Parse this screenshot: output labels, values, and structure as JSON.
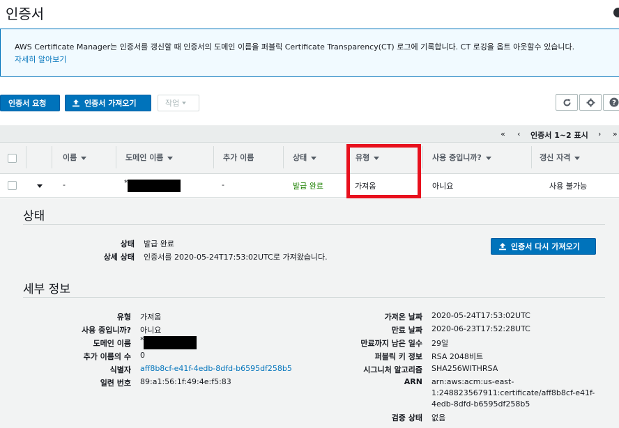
{
  "page": {
    "title": "인증서"
  },
  "info": {
    "text": "AWS Certificate Manager는 인증서를 갱신할 때 인증서의 도메인 이름을 퍼블릭 Certificate Transparency(CT) 로그에 기록합니다. CT 로깅을 옵트 아웃할수 있습니다.",
    "link": "자세히 알아보기",
    "border_color": "#0073bb"
  },
  "toolbar": {
    "request_label": "인증서 요청",
    "import_label": "인증서 가져오기",
    "actions_label": "작업",
    "icons": [
      "refresh-icon",
      "gear-icon",
      "help-icon"
    ]
  },
  "pager": {
    "first": "«",
    "prev": "‹",
    "label": "인증서 1~2 표시",
    "next": "›",
    "last": "»"
  },
  "table": {
    "columns": [
      "이름",
      "도메인 이름",
      "추가 이름",
      "상태",
      "유형",
      "사용 중입니까?",
      "갱신 자격"
    ],
    "rows": [
      {
        "name": "-",
        "domain": "*",
        "additional": "-",
        "status": "발급 완료",
        "type": "가져옴",
        "in_use": "아니요",
        "renewal": "사용 불가능"
      }
    ],
    "status_color": "#1d8102",
    "highlight_color": "#e8101d"
  },
  "status_section": {
    "title": "상태",
    "status_label": "상태",
    "status_value": "발급 완료",
    "detail_label": "상세 상태",
    "detail_value": "인증서를 2020-05-24T17:53:02UTC로 가져왔습니다.",
    "reimport_label": "인증서 다시 가져오기"
  },
  "details": {
    "title": "세부 정보",
    "left": [
      {
        "label": "유형",
        "value": "가져옴"
      },
      {
        "label": "사용 중입니까?",
        "value": "아니요"
      },
      {
        "label": "도메인 이름",
        "value": "*"
      },
      {
        "label": "추가 이름의 수",
        "value": "0"
      },
      {
        "label": "식별자",
        "value": "aff8b8cf-e41f-4edb-8dfd-b6595df258b5"
      },
      {
        "label": "일련 번호",
        "value": "89:a1:56:1f:49:4e:f5:83"
      }
    ],
    "right": [
      {
        "label": "가져온 날짜",
        "value": "2020-05-24T17:53:02UTC"
      },
      {
        "label": "만료 날짜",
        "value": "2020-06-23T17:52:28UTC"
      },
      {
        "label": "만료까지 남은 일수",
        "value": "29일"
      },
      {
        "label": "퍼블릭 키 정보",
        "value": "RSA 2048비트"
      },
      {
        "label": "시그니처 알고리즘",
        "value": "SHA256WITHRSA"
      },
      {
        "label": "ARN",
        "value_lines": [
          "arn:aws:acm:us-east-",
          "1:248823567911:certificate/aff8b8cf-e41f-",
          "4edb-8dfd-b6595df258b5"
        ]
      },
      {
        "label": "검증 상태",
        "value": "없음"
      }
    ]
  }
}
